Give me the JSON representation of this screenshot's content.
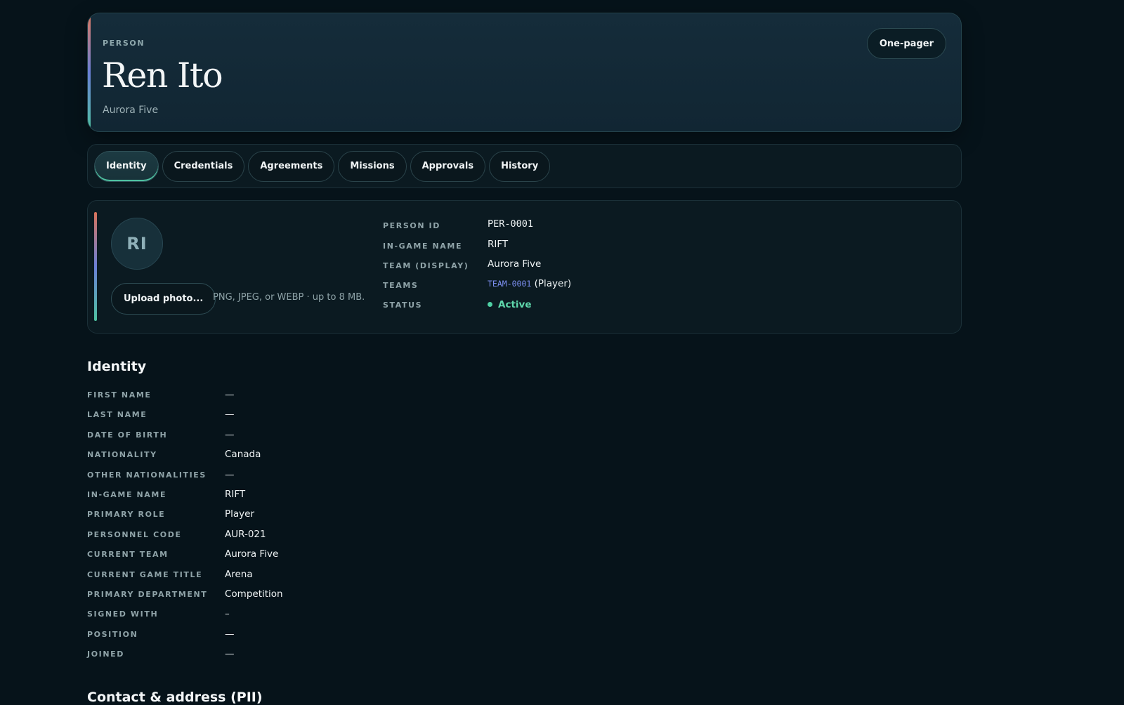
{
  "header": {
    "eyebrow": "PERSON",
    "title": "Ren Ito",
    "subtitle": "Aurora Five",
    "one_pager_label": "One-pager"
  },
  "tabs": [
    {
      "label": "Identity",
      "active": true
    },
    {
      "label": "Credentials",
      "active": false
    },
    {
      "label": "Agreements",
      "active": false
    },
    {
      "label": "Missions",
      "active": false
    },
    {
      "label": "Approvals",
      "active": false
    },
    {
      "label": "History",
      "active": false
    }
  ],
  "profile": {
    "initials": "RI",
    "upload_label": "Upload photo...",
    "upload_hint": "PNG, JPEG, or WEBP · up to 8 MB.",
    "fields": {
      "person_id_label": "PERSON ID",
      "person_id": "PER-0001",
      "ign_label": "IN-GAME NAME",
      "ign": "RIFT",
      "team_display_label": "TEAM (DISPLAY)",
      "team_display": "Aurora Five",
      "teams_label": "TEAMS",
      "team_code": "TEAM-0001",
      "team_role": "(Player)",
      "status_label": "STATUS",
      "status": "Active"
    }
  },
  "identity": {
    "title": "Identity",
    "rows": [
      {
        "label": "FIRST NAME",
        "value": "—"
      },
      {
        "label": "LAST NAME",
        "value": "—"
      },
      {
        "label": "DATE OF BIRTH",
        "value": "—"
      },
      {
        "label": "NATIONALITY",
        "value": "Canada"
      },
      {
        "label": "OTHER NATIONALITIES",
        "value": "—"
      },
      {
        "label": "IN-GAME NAME",
        "value": "RIFT"
      },
      {
        "label": "PRIMARY ROLE",
        "value": "Player"
      },
      {
        "label": "PERSONNEL CODE",
        "value": "AUR-021"
      },
      {
        "label": "CURRENT TEAM",
        "value": "Aurora Five"
      },
      {
        "label": "CURRENT GAME TITLE",
        "value": "Arena"
      },
      {
        "label": "PRIMARY DEPARTMENT",
        "value": "Competition"
      },
      {
        "label": "SIGNED WITH",
        "value": "–"
      },
      {
        "label": "POSITION",
        "value": "—"
      },
      {
        "label": "JOINED",
        "value": "—"
      }
    ]
  },
  "contact": {
    "title": "Contact & address (PII)"
  },
  "colors": {
    "background": "#06131a",
    "accent_green": "#4fc3a1",
    "status_active": "#5fd8ac",
    "team_link": "#7c8ff0"
  }
}
